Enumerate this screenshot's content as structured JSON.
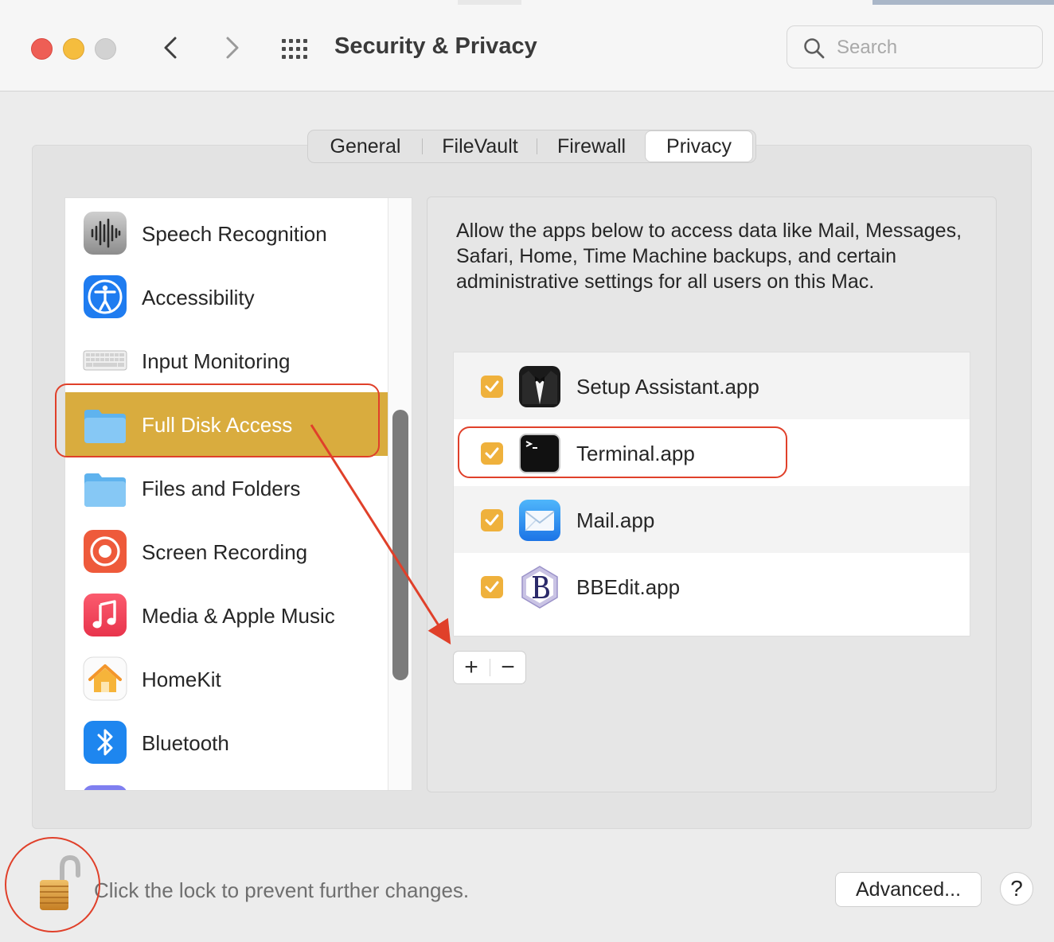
{
  "window": {
    "title": "Security & Privacy",
    "traffic_lights": {
      "close": "#ee5e55",
      "minimize": "#f5bd3e",
      "zoom": "#d2d2d2"
    }
  },
  "search": {
    "placeholder": "Search"
  },
  "tabs": [
    {
      "label": "General"
    },
    {
      "label": "FileVault"
    },
    {
      "label": "Firewall"
    },
    {
      "label": "Privacy",
      "active": true
    }
  ],
  "sidebar": {
    "items": [
      {
        "label": "Speech Recognition",
        "icon": "waveform-icon"
      },
      {
        "label": "Accessibility",
        "icon": "accessibility-icon"
      },
      {
        "label": "Input Monitoring",
        "icon": "keyboard-icon"
      },
      {
        "label": "Full Disk Access",
        "icon": "folder-icon",
        "selected": true
      },
      {
        "label": "Files and Folders",
        "icon": "folder-icon"
      },
      {
        "label": "Screen Recording",
        "icon": "screen-record-icon"
      },
      {
        "label": "Media & Apple Music",
        "icon": "music-note-icon"
      },
      {
        "label": "HomeKit",
        "icon": "home-icon"
      },
      {
        "label": "Bluetooth",
        "icon": "bluetooth-icon"
      }
    ],
    "selected_color": "#d9ac3e"
  },
  "main": {
    "description": "Allow the apps below to access data like Mail, Messages, Safari, Home, Time Machine backups, and certain administrative settings for all users on this Mac.",
    "apps": [
      {
        "name": "Setup Assistant.app",
        "icon": "setup-assistant-icon",
        "checked": true
      },
      {
        "name": "Terminal.app",
        "icon": "terminal-icon",
        "checked": true
      },
      {
        "name": "Mail.app",
        "icon": "mail-icon",
        "checked": true
      },
      {
        "name": "BBEdit.app",
        "icon": "bbedit-icon",
        "checked": true
      }
    ],
    "add_label": "+",
    "remove_label": "−",
    "check_color": "#efb13c"
  },
  "footer": {
    "lock_text": "Click the lock to prevent further changes.",
    "advanced_label": "Advanced...",
    "help_label": "?"
  },
  "annotation_color": "#e0402a"
}
